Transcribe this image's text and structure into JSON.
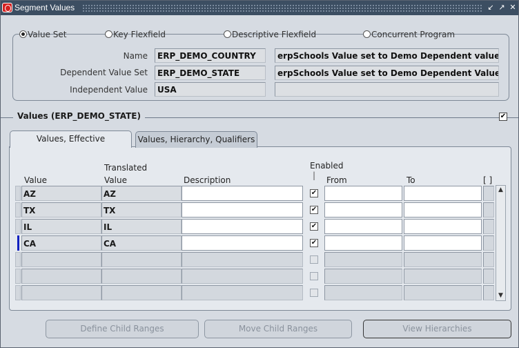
{
  "window": {
    "title": "Segment Values",
    "buttons": [
      "↙",
      "↗",
      "✕"
    ]
  },
  "value_set_type": {
    "options": [
      "Value Set",
      "Key Flexfield",
      "Descriptive Flexfield",
      "Concurrent Program"
    ],
    "selected": "Value Set"
  },
  "fields": {
    "name_label": "Name",
    "name_value": "ERP_DEMO_COUNTRY",
    "name_desc": "erpSchools Value set to Demo Dependent value se",
    "dependent_label": "Dependent Value Set",
    "dependent_value": "ERP_DEMO_STATE",
    "dependent_desc": "erpSchools Value set to Demo Dependent Value se",
    "independent_label": "Independent Value",
    "independent_value": "USA",
    "independent_desc": ""
  },
  "values_section": {
    "title": "Values (ERP_DEMO_STATE)",
    "checked": true
  },
  "tabs": [
    "Values, Effective",
    "Values, Hierarchy, Qualifiers"
  ],
  "columns": {
    "value": "Value",
    "translated_top": "Translated",
    "translated_bottom": "Value",
    "description": "Description",
    "enabled": "Enabled",
    "enabled_mark": "|",
    "from": "From",
    "to": "To",
    "flex": "[ ]"
  },
  "rows": [
    {
      "value": "AZ",
      "translated": "AZ",
      "description": "",
      "enabled": true
    },
    {
      "value": "TX",
      "translated": "TX",
      "description": "",
      "enabled": true
    },
    {
      "value": "IL",
      "translated": "IL",
      "description": "",
      "enabled": true
    },
    {
      "value": "CA",
      "translated": "CA",
      "description": "",
      "enabled": true,
      "current": true
    },
    {
      "value": "",
      "translated": "",
      "description": "",
      "enabled": false
    },
    {
      "value": "",
      "translated": "",
      "description": "",
      "enabled": false
    },
    {
      "value": "",
      "translated": "",
      "description": "",
      "enabled": false
    }
  ],
  "buttons": {
    "define_child_ranges": "Define Child Ranges",
    "move_child_ranges": "Move Child Ranges",
    "view_hierarchies": "View Hierarchies"
  },
  "colors": {
    "titlebar": "#3c4e62",
    "accent": "#1020c0"
  }
}
